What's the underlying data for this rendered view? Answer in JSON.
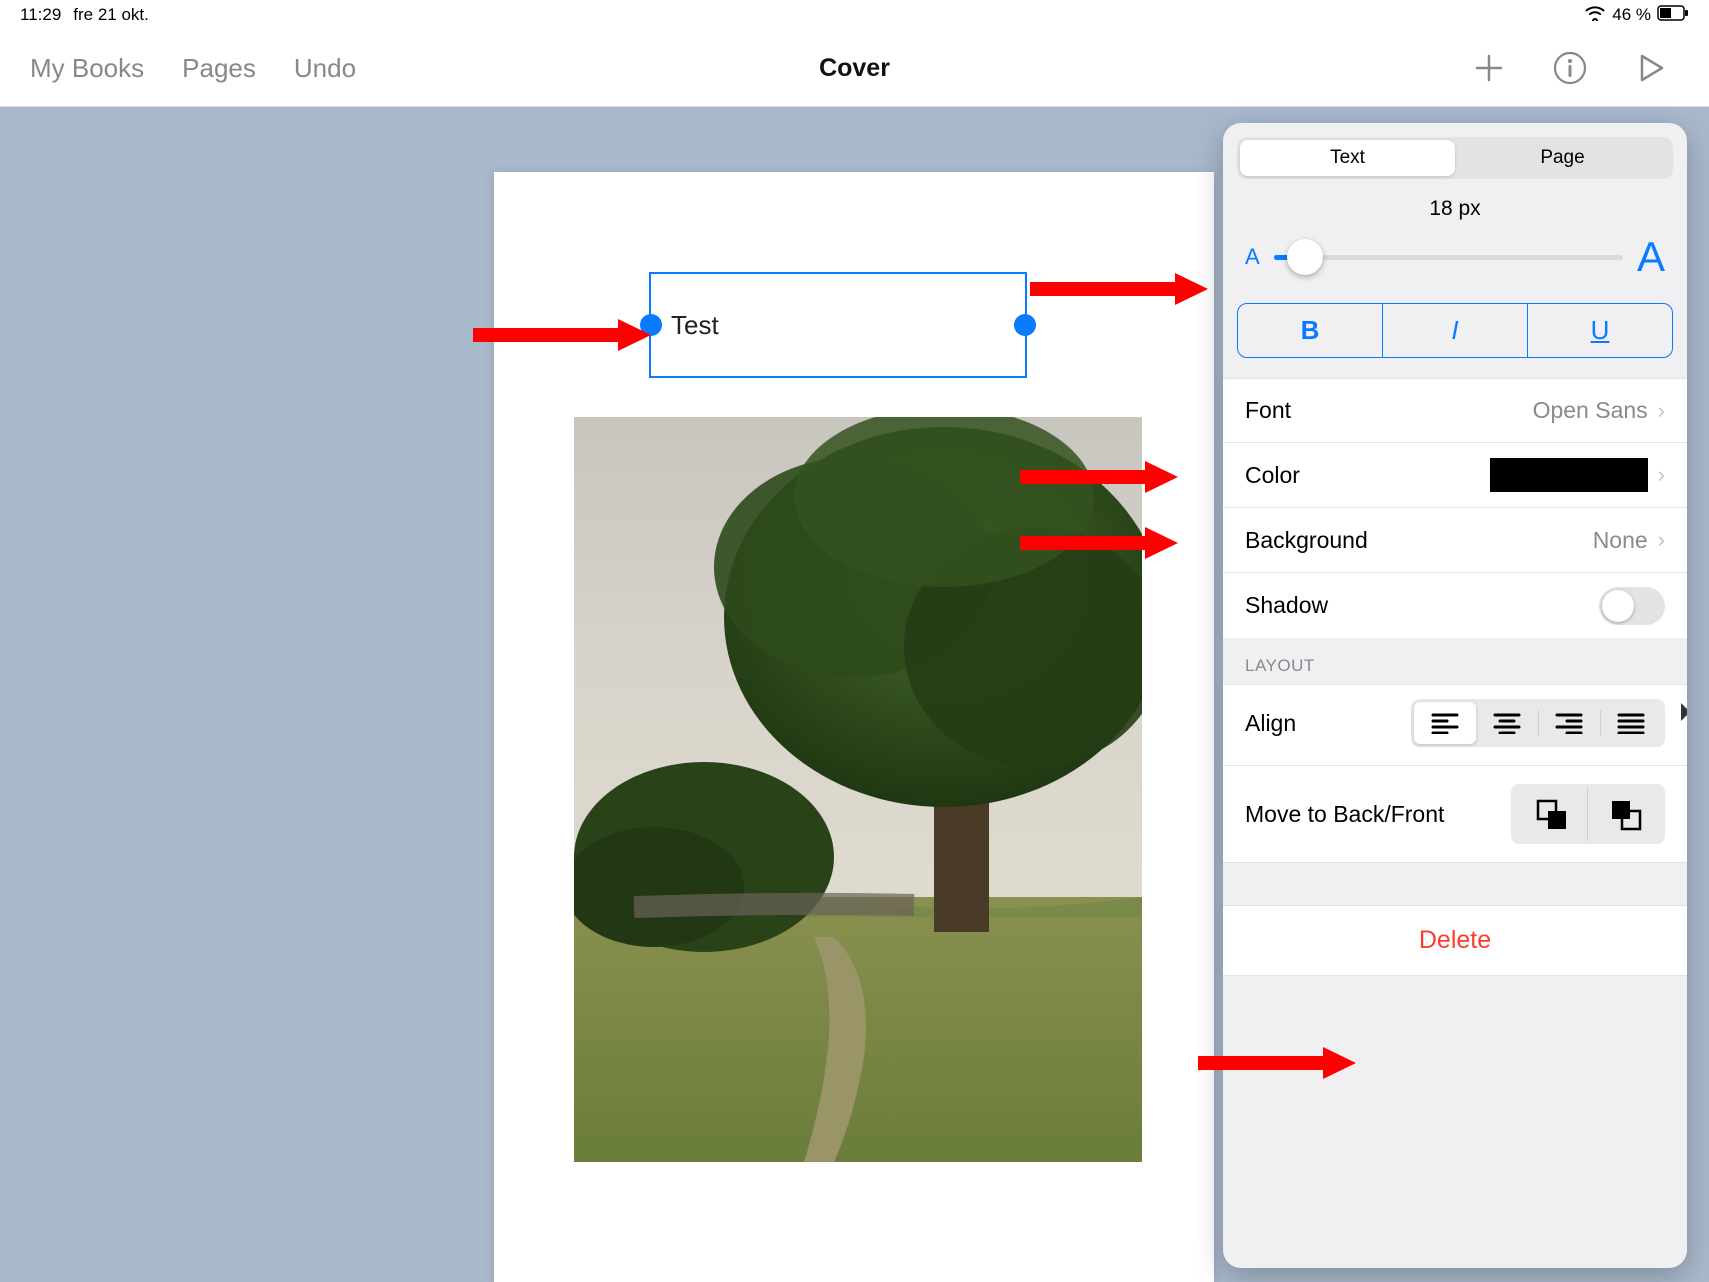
{
  "status": {
    "time": "11:29",
    "date": "fre 21 okt.",
    "battery": "46 %"
  },
  "toolbar": {
    "nav": [
      "My Books",
      "Pages",
      "Undo"
    ],
    "title": "Cover"
  },
  "textbox": {
    "content": "Test"
  },
  "inspector": {
    "tabs": [
      "Text",
      "Page"
    ],
    "size": {
      "label": "18 px",
      "small": "A",
      "big": "A"
    },
    "style": {
      "bold": "B",
      "italic": "I",
      "underline": "U"
    },
    "font": {
      "label": "Font",
      "value": "Open Sans"
    },
    "color": {
      "label": "Color"
    },
    "background": {
      "label": "Background",
      "value": "None"
    },
    "shadow": {
      "label": "Shadow"
    },
    "layout_header": "LAYOUT",
    "align": {
      "label": "Align"
    },
    "move": {
      "label": "Move to Back/Front"
    },
    "delete": "Delete"
  }
}
